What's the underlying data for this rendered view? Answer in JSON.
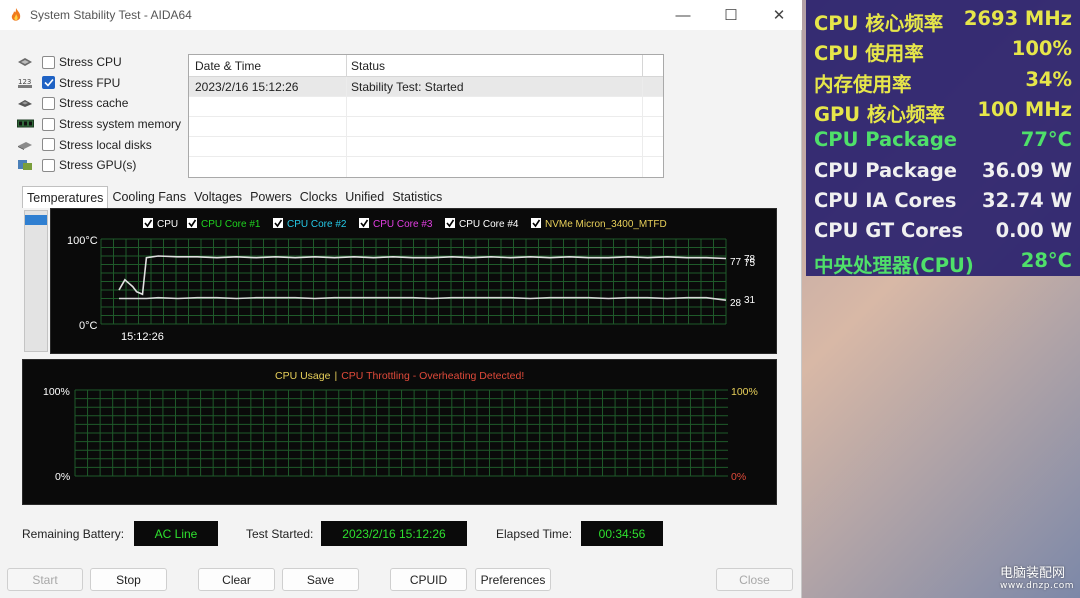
{
  "window": {
    "title": "System Stability Test - AIDA64",
    "minimize": "—",
    "maximize": "☐",
    "close": "✕"
  },
  "stress_items": [
    {
      "label": "Stress CPU",
      "checked": false,
      "icon": "cpu-chip-icon"
    },
    {
      "label": "Stress FPU",
      "checked": true,
      "icon": "fpu-123-icon"
    },
    {
      "label": "Stress cache",
      "checked": false,
      "icon": "cache-chip-icon"
    },
    {
      "label": "Stress system memory",
      "checked": false,
      "icon": "memory-module-icon"
    },
    {
      "label": "Stress local disks",
      "checked": false,
      "icon": "disk-drive-icon"
    },
    {
      "label": "Stress GPU(s)",
      "checked": false,
      "icon": "gpu-card-icon"
    }
  ],
  "log": {
    "headers": {
      "datetime": "Date & Time",
      "status": "Status"
    },
    "rows": [
      {
        "datetime": "2023/2/16 15:12:26",
        "status": "Stability Test: Started"
      }
    ]
  },
  "tabs": [
    "Temperatures",
    "Cooling Fans",
    "Voltages",
    "Powers",
    "Clocks",
    "Unified",
    "Statistics"
  ],
  "active_tab": 0,
  "temp_chart": {
    "legend": [
      {
        "label": "CPU",
        "color": "#ffffff"
      },
      {
        "label": "CPU Core #1",
        "color": "#1fd31f"
      },
      {
        "label": "CPU Core #2",
        "color": "#25c8e6"
      },
      {
        "label": "CPU Core #3",
        "color": "#e23fe2"
      },
      {
        "label": "CPU Core #4",
        "color": "#ffffff"
      },
      {
        "label": "NVMe Micron_3400_MTFD",
        "color": "#e8d05a"
      }
    ],
    "y_top": "100°C",
    "y_bottom": "0°C",
    "x_label": "15:12:26",
    "end_labels": {
      "a": "77",
      "b": "78",
      "c": "75",
      "d": "28",
      "e": "31"
    }
  },
  "usage_chart": {
    "title_left": "CPU Usage",
    "separator": "|",
    "title_right": "CPU Throttling - Overheating Detected!",
    "left_top": "100%",
    "left_bottom": "0%",
    "right_top": "100%",
    "right_bottom": "0%"
  },
  "chart_data": [
    {
      "type": "line",
      "x": [
        0,
        6,
        10,
        14,
        18,
        22,
        24,
        28,
        40,
        60,
        80,
        100,
        120,
        140,
        160,
        180,
        200,
        220,
        240,
        260,
        280,
        300,
        320,
        340,
        360,
        380,
        400,
        420,
        440,
        460,
        480,
        500,
        520,
        540,
        560,
        580,
        600,
        620
      ],
      "series": [
        {
          "name": "CPU",
          "values": [
            40,
            52,
            48,
            44,
            38,
            36,
            35,
            78,
            80,
            79,
            79,
            78,
            79,
            78,
            79,
            78,
            79,
            78,
            79,
            78,
            79,
            78,
            78,
            79,
            78,
            79,
            78,
            79,
            78,
            79,
            78,
            78,
            79,
            78,
            79,
            78,
            78,
            77
          ]
        },
        {
          "name": "NVMe Micron_3400_MTFD",
          "values": [
            30,
            30,
            30,
            30,
            30,
            30,
            30,
            30,
            31,
            30,
            31,
            31,
            30,
            31,
            31,
            31,
            30,
            31,
            31,
            31,
            31,
            31,
            30,
            31,
            31,
            31,
            31,
            30,
            31,
            31,
            31,
            30,
            31,
            31,
            30,
            31,
            31,
            28
          ]
        }
      ],
      "xlabel": "",
      "ylabel": "",
      "ylim": [
        0,
        100
      ]
    },
    {
      "type": "line",
      "series": [],
      "ylim": [
        0,
        100
      ]
    }
  ],
  "status": {
    "battery_label": "Remaining Battery:",
    "battery_value": "AC Line",
    "started_label": "Test Started:",
    "started_value": "2023/2/16 15:12:26",
    "elapsed_label": "Elapsed Time:",
    "elapsed_value": "00:34:56"
  },
  "buttons": {
    "start": "Start",
    "stop": "Stop",
    "clear": "Clear",
    "save": "Save",
    "cpuid": "CPUID",
    "preferences": "Preferences",
    "close": "Close"
  },
  "overlay": [
    {
      "label": "CPU 核心频率",
      "value": "2693 MHz",
      "color": "#e6e64a"
    },
    {
      "label": "CPU 使用率",
      "value": "100%",
      "color": "#e6e64a"
    },
    {
      "label": "内存使用率",
      "value": "34%",
      "color": "#e6e64a"
    },
    {
      "label": "GPU 核心频率",
      "value": "100 MHz",
      "color": "#e6e64a"
    },
    {
      "label": "CPU Package",
      "value": "77°C",
      "color": "#4fe06a"
    },
    {
      "label": "CPU Package",
      "value": "36.09 W",
      "color": "#f0f0f0"
    },
    {
      "label": "CPU IA Cores",
      "value": "32.74 W",
      "color": "#f0f0f0"
    },
    {
      "label": "CPU GT Cores",
      "value": "0.00 W",
      "color": "#f0f0f0"
    },
    {
      "label": "中央处理器(CPU)",
      "value": "28°C",
      "color": "#4fe06a"
    }
  ],
  "watermark": {
    "name": "电脑装配网",
    "url": "www.dnzp.com"
  }
}
